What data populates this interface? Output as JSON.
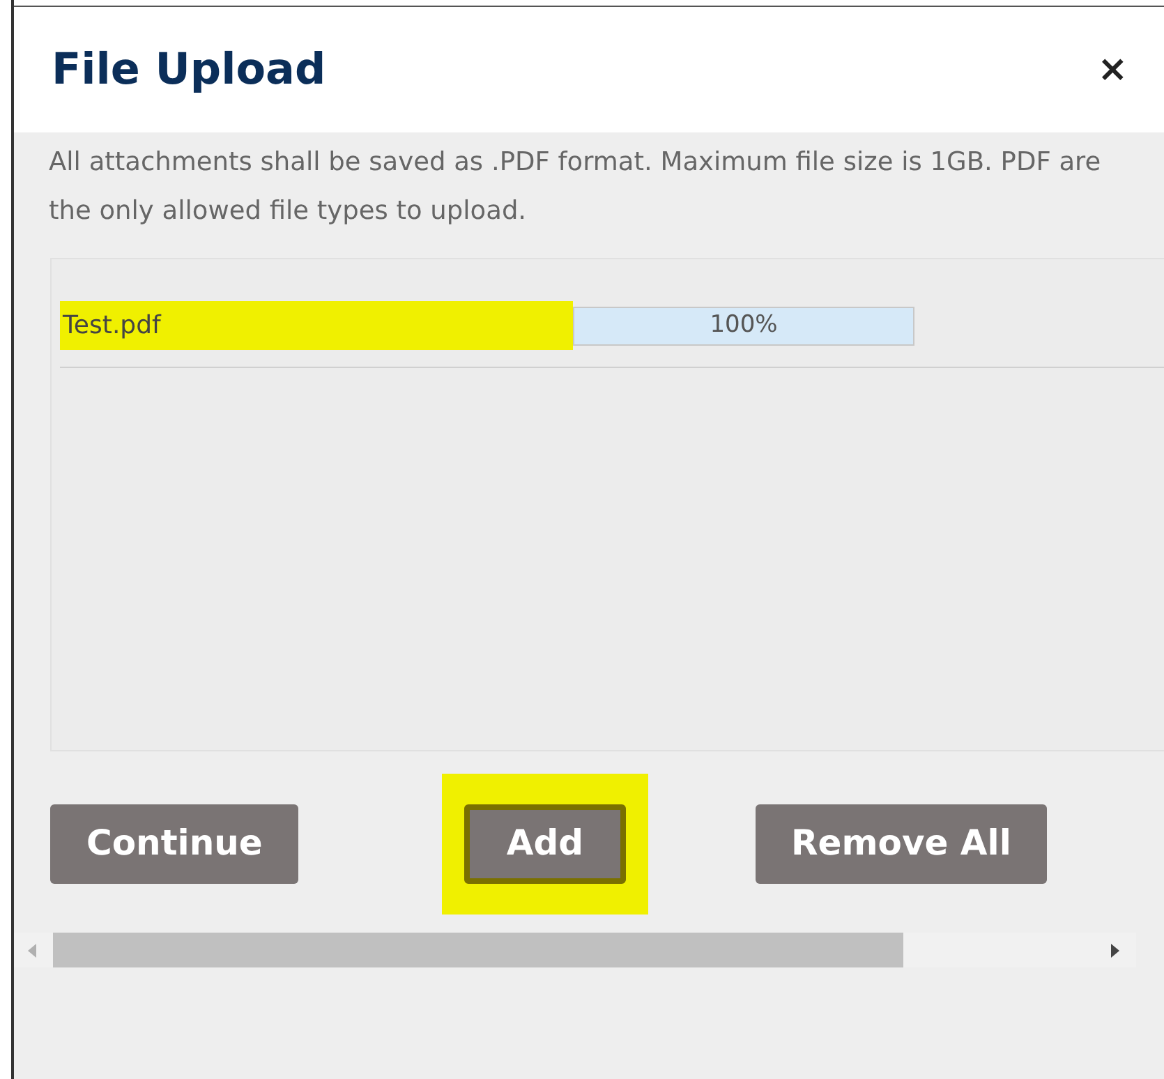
{
  "dialog": {
    "title": "File Upload",
    "close": "×"
  },
  "notice": "All attachments shall be saved as .PDF format. Maximum file size is 1GB. PDF are the only allowed file types to upload.",
  "files": [
    {
      "name": "Test.pdf",
      "highlighted": true,
      "level": 1,
      "reading": "100%"
    }
  ],
  "buttons": [
    {
      "label": "Continue",
      "highlighted": false
    },
    {
      "label": "Add",
      "highlighted": true
    },
    {
      "label": "Remove All",
      "highlighted": false
    }
  ]
}
